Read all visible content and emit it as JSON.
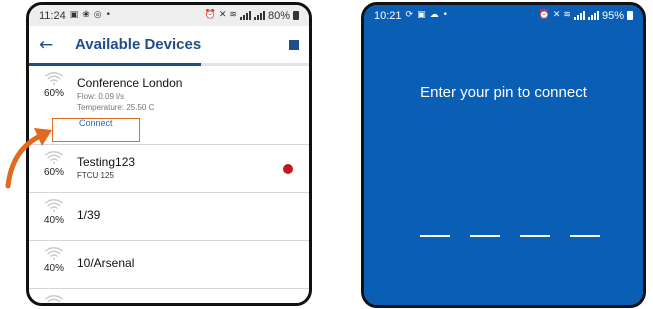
{
  "left_phone": {
    "status": {
      "time": "11:24",
      "left_icons": [
        "gallery-icon",
        "photo-icon",
        "instagram-icon",
        "dot-icon"
      ],
      "right_icons": [
        "alarm-icon",
        "mute-icon",
        "wifi-icon"
      ],
      "battery": "80%"
    },
    "appbar": {
      "title": "Available Devices"
    },
    "devices": [
      {
        "name": "Conference London",
        "signal": "60%",
        "flow": "Flow: 0.09 l/s",
        "temperature": "Temperature: 25.50 C",
        "action": "Connect"
      },
      {
        "name": "Testing123",
        "signal": "60%",
        "sub": "FTCU 125",
        "status_color": "#c4161c"
      },
      {
        "name": "1/39",
        "signal": "40%"
      },
      {
        "name": "10/Arsenal",
        "signal": "40%"
      }
    ]
  },
  "right_phone": {
    "status": {
      "time": "10:21",
      "left_icons": [
        "sync-icon",
        "image-icon",
        "cloud-icon",
        "dot-icon"
      ],
      "battery": "95%"
    },
    "prompt": "Enter your pin to connect",
    "pin_length": 4
  },
  "colors": {
    "primary": "#1f4e8c",
    "link": "#1e6fc6",
    "accent_orange": "#e06a1d",
    "pin_background": "#0a5fb5",
    "status_dot": "#c4161c"
  }
}
